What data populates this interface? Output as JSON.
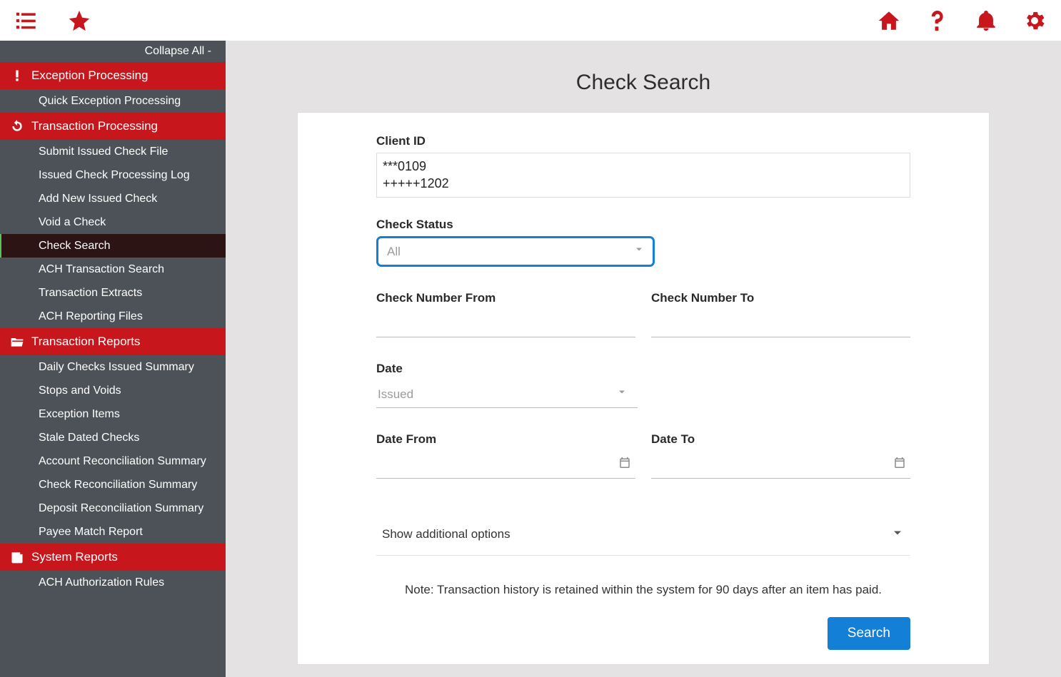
{
  "topbar": {
    "icons": {
      "menu": "menu",
      "star": "star",
      "home": "home",
      "help": "help",
      "bell": "bell",
      "gear": "gear"
    }
  },
  "sidebar": {
    "collapse_label": "Collapse All -",
    "sections": [
      {
        "title": "Exception Processing",
        "items": [
          "Quick Exception Processing"
        ]
      },
      {
        "title": "Transaction Processing",
        "items": [
          "Submit Issued Check File",
          "Issued Check Processing Log",
          "Add New Issued Check",
          "Void a Check",
          "Check Search",
          "ACH Transaction Search",
          "Transaction Extracts",
          "ACH Reporting Files"
        ],
        "selected": "Check Search"
      },
      {
        "title": "Transaction Reports",
        "items": [
          "Daily Checks Issued Summary",
          "Stops and Voids",
          "Exception Items",
          "Stale Dated Checks",
          "Account Reconciliation Summary",
          "Check Reconciliation Summary",
          "Deposit Reconciliation Summary",
          "Payee Match Report"
        ]
      },
      {
        "title": "System Reports",
        "items": [
          "ACH Authorization Rules"
        ]
      }
    ]
  },
  "page": {
    "title": "Check Search",
    "client_id_label": "Client ID",
    "client_ids": [
      "***0109",
      "+++++1202"
    ],
    "check_status_label": "Check Status",
    "check_status_value": "All",
    "check_number_from_label": "Check Number From",
    "check_number_to_label": "Check Number To",
    "check_number_from_value": "",
    "check_number_to_value": "",
    "date_label": "Date",
    "date_type_value": "Issued",
    "date_from_label": "Date From",
    "date_to_label": "Date To",
    "date_from_value": "",
    "date_to_value": "",
    "additional_label": "Show additional options",
    "note": "Note: Transaction history is retained within the system for 90 days after an item has paid.",
    "search_label": "Search"
  }
}
